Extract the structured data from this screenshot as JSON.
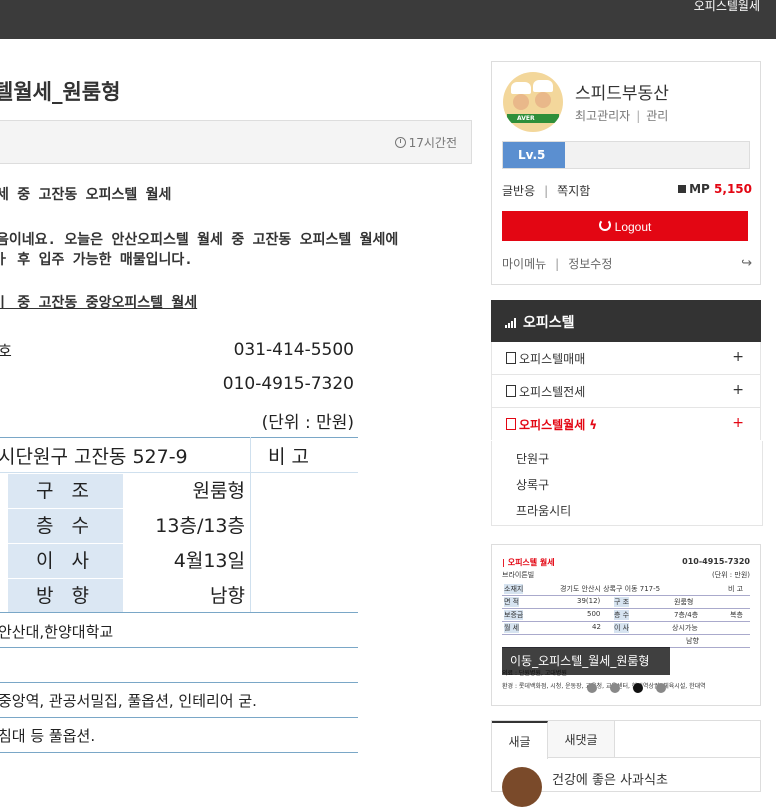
{
  "topbar": {
    "breadcrumb": "오피스텔월세"
  },
  "post": {
    "title": "텔월세_원룸형",
    "time": "17시간전",
    "lines": [
      "세 중 고잔동 오피스텔 월세",
      "음이네요. 오늘은 안산오피스텔 월세 중 고잔동 오피스텔 월세에",
      "ㅏ 후 입주 가능한 매물입니다.",
      "ㅣ 중 고잔동 중앙오피스텔 월세"
    ]
  },
  "listing": {
    "corner_label": "호",
    "phone1": "031-414-5500",
    "phone2": "010-4915-7320",
    "unit": "(단위 : 만원)",
    "address": "시단원구 고잔동 527-9",
    "note": "비    고",
    "rows": [
      {
        "label": "구  조",
        "value": "원룸형"
      },
      {
        "label": "층  수",
        "value": "13층/13층"
      },
      {
        "label": "이  사",
        "value": "4월13일"
      },
      {
        "label": "방  향",
        "value": "남향"
      }
    ],
    "school": "안산대,한양대학교",
    "features": "중앙역, 관공서밀집, 풀옵션, 인테리어 굳.",
    "options": " 침대 등 풀옵션."
  },
  "profile": {
    "avatar_badge": "AVER",
    "name": "스피드부동산",
    "role": "최고관리자",
    "admin_link": "관리",
    "level": "Lv.5",
    "level_progress": 0.25,
    "link_posts": "글반응",
    "link_memo": "쪽지함",
    "mp_label": "MP",
    "mp_value": "5,150",
    "logout": "Logout",
    "mymenu": "마이메뉴",
    "edit_info": "정보수정"
  },
  "menu": {
    "header": "오피스텔",
    "items": [
      {
        "label": "오피스텔매매",
        "plus": "+"
      },
      {
        "label": "오피스텔전세",
        "plus": "+"
      },
      {
        "label": "오피스텔월세",
        "plus": "+"
      }
    ],
    "bolt": "ϟ",
    "subitems": [
      "단원구",
      "상록구",
      "프라움시티"
    ]
  },
  "banner": {
    "title": "| 오피스텔 월세",
    "phone": "010-4915-7320",
    "building": "브라이튼빌",
    "unit": "(단위 : 만원)",
    "r1": [
      "소재지",
      "경기도 안산시 상록구 이동 717-5",
      "비  고"
    ],
    "r2": [
      "면  적",
      "39(12)",
      "구  조",
      "원룸형"
    ],
    "r3": [
      "보증금",
      "500",
      "층  수",
      "7층/4층",
      "복층"
    ],
    "r4": [
      "월  세",
      "42",
      "이  사",
      "상시가능"
    ],
    "r5": [
      "",
      "",
      "",
      "남향"
    ],
    "f1": "의료 : 단원병원, 고대병원",
    "f2": "환경 : 롯데백화점, 시청, 운동장, 교육청, 교육센터, 한대역상권, 체육시설, 한대역",
    "caption": "이동_오피스텔_월세_원룸형",
    "dots_active": 3
  },
  "tabs": {
    "tab1": "새글",
    "tab2": "새댓글"
  },
  "recent": {
    "title": "건강에 좋은 사과식초"
  }
}
